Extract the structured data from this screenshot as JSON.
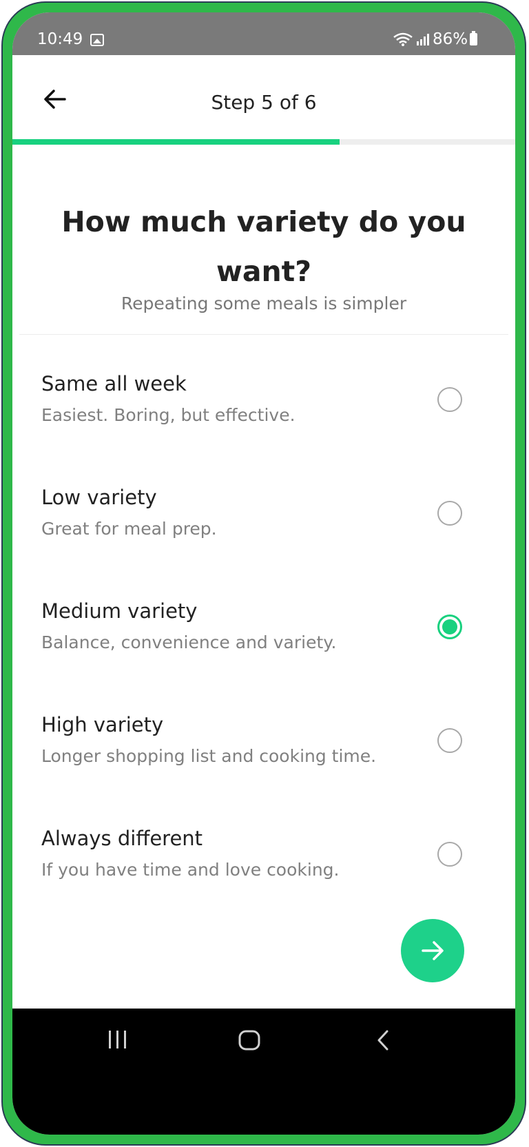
{
  "status_bar": {
    "time": "10:49",
    "battery": "86%",
    "icons": [
      "image-notification-icon",
      "wifi-icon",
      "signal-icon",
      "battery-icon"
    ]
  },
  "header": {
    "title": "Step 5 of 6",
    "back_icon": "arrow-left-icon"
  },
  "progress": {
    "current_step": 5,
    "total_steps": 6,
    "fraction": 0.65
  },
  "question": {
    "title": "How much variety do you want?",
    "subtitle": "Repeating some meals is simpler"
  },
  "options": [
    {
      "label": "Same all week",
      "description": "Easiest. Boring, but effective.",
      "selected": false
    },
    {
      "label": "Low variety",
      "description": "Great for meal prep.",
      "selected": false
    },
    {
      "label": "Medium variety",
      "description": "Balance, convenience and variety.",
      "selected": true
    },
    {
      "label": "High variety",
      "description": "Longer shopping list and cooking time.",
      "selected": false
    },
    {
      "label": "Always different",
      "description": "If you have time and love cooking.",
      "selected": false
    }
  ],
  "next_button": {
    "icon": "arrow-right-icon"
  },
  "nav_bar": {
    "icons": [
      "recent-apps-icon",
      "home-icon",
      "back-nav-icon"
    ]
  },
  "colors": {
    "accent": "#18d17f",
    "frame_border": "#2fb84a",
    "status_bar_bg": "#7a7a7a",
    "nav_bar_bg": "#000000"
  }
}
